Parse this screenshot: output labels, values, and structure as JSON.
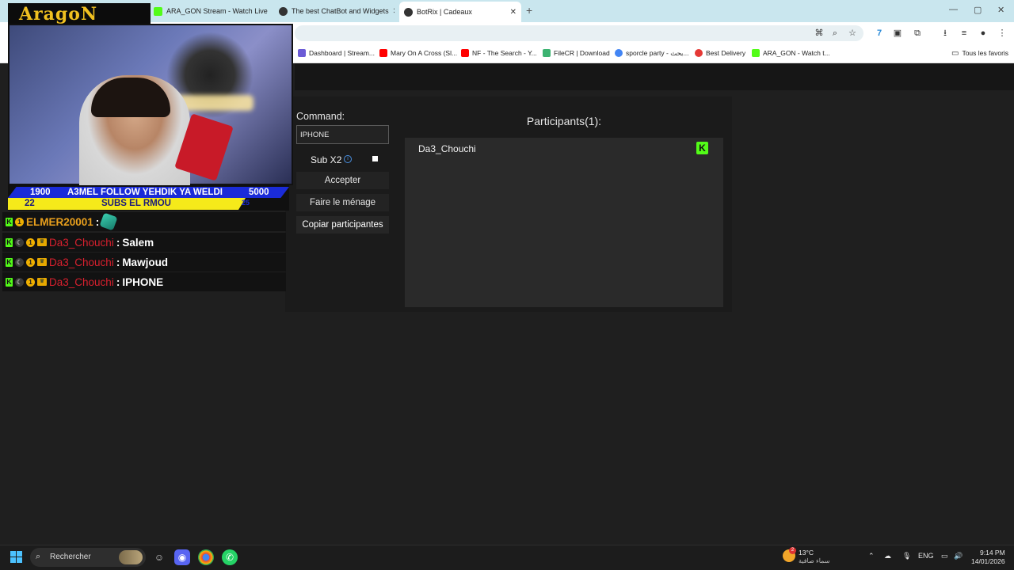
{
  "browser": {
    "tabs": [
      {
        "label": "ARA_GON Stream - Watch Live",
        "active": false,
        "fav_color": "#53fc18"
      },
      {
        "label": "The best ChatBot and Widgets",
        "active": false,
        "fav_color": "#333333"
      },
      {
        "label": "BotRix | Cadeaux",
        "active": true,
        "fav_color": "#333333"
      }
    ],
    "new_tab": "+",
    "window_controls": [
      "—",
      "▢",
      "✕"
    ],
    "bookmarks": [
      {
        "label": "Dashboard | Stream...",
        "fav_color": "#6b5bd6"
      },
      {
        "label": "Mary On A Cross (Sl...",
        "fav_color": "#ff0000"
      },
      {
        "label": "NF - The Search - Y...",
        "fav_color": "#ff0000"
      },
      {
        "label": "FileCR | Download",
        "fav_color": "#3cb371"
      },
      {
        "label": "sporcle party - بحث...",
        "fav_color": "#4285f4"
      },
      {
        "label": "Best Delivery",
        "fav_color": "#e53935"
      },
      {
        "label": "ARA_GON - Watch t...",
        "fav_color": "#53fc18"
      }
    ],
    "all_bookmarks": "Tous les favoris"
  },
  "overlay": {
    "logo": "AragoN",
    "ticker": {
      "num_left_top": "1900",
      "msg_top": "A3MEL FOLLOW YEHDIK YA WELDI",
      "num_right_top": "5000",
      "num_left_bottom": "22",
      "msg_bottom": "SUBS EL RMOU",
      "num_right_bottom": "25"
    },
    "chat": [
      {
        "user": "ELMER20001",
        "sep": " :",
        "msg": "",
        "style": "gold"
      },
      {
        "user": "Da3_Chouchi",
        "sep": " :",
        "msg": " Salem",
        "style": "red"
      },
      {
        "user": "Da3_Chouchi",
        "sep": " :",
        "msg": " Mawjoud",
        "style": "red"
      },
      {
        "user": "Da3_Chouchi",
        "sep": " :",
        "msg": " IPHONE",
        "style": "red"
      }
    ]
  },
  "giveaway": {
    "command_label": "Command:",
    "command_value": "IPHONE",
    "sub_label": "Sub X2",
    "sub_checked": true,
    "accept_label": "Accepter",
    "clear_label": "Faire le ménage",
    "copy_label": "Copiar participantes",
    "participants_title": "Participants(1):",
    "participants": [
      {
        "name": "Da3_Chouchi",
        "platform": "K"
      }
    ]
  },
  "taskbar": {
    "search_placeholder": "Rechercher",
    "weather_temp": "13°C",
    "weather_desc": "سماء صافية",
    "weather_badge": "2",
    "lang": "ENG",
    "time": "9:14 PM",
    "date": "14/01/2026"
  },
  "colors": {
    "kick_green": "#53fc18",
    "page_bg": "#1f1f1f",
    "tab_strip": "#c9e6ee",
    "user_red": "#d8202e",
    "user_gold": "#e9a01d"
  }
}
